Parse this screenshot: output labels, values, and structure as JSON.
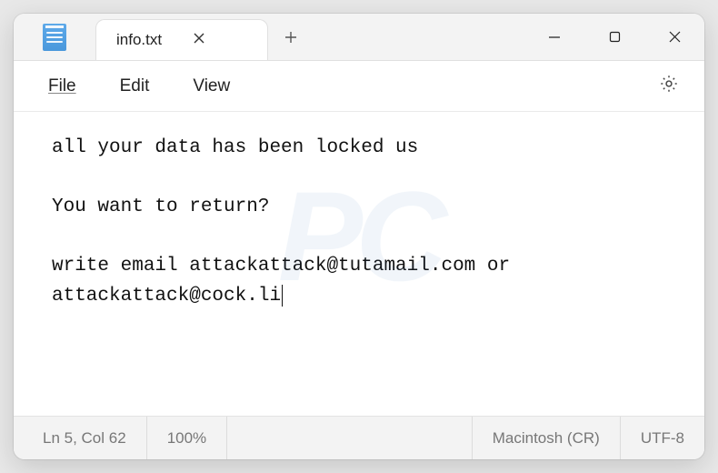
{
  "tab": {
    "title": "info.txt"
  },
  "menu": {
    "file": "File",
    "edit": "Edit",
    "view": "View"
  },
  "content": {
    "text": "all your data has been locked us\n\nYou want to return?\n\nwrite email attackattack@tutamail.com or attackattack@cock.li"
  },
  "status": {
    "position": "Ln 5, Col 62",
    "zoom": "100%",
    "lineEnding": "Macintosh (CR)",
    "encoding": "UTF-8"
  }
}
